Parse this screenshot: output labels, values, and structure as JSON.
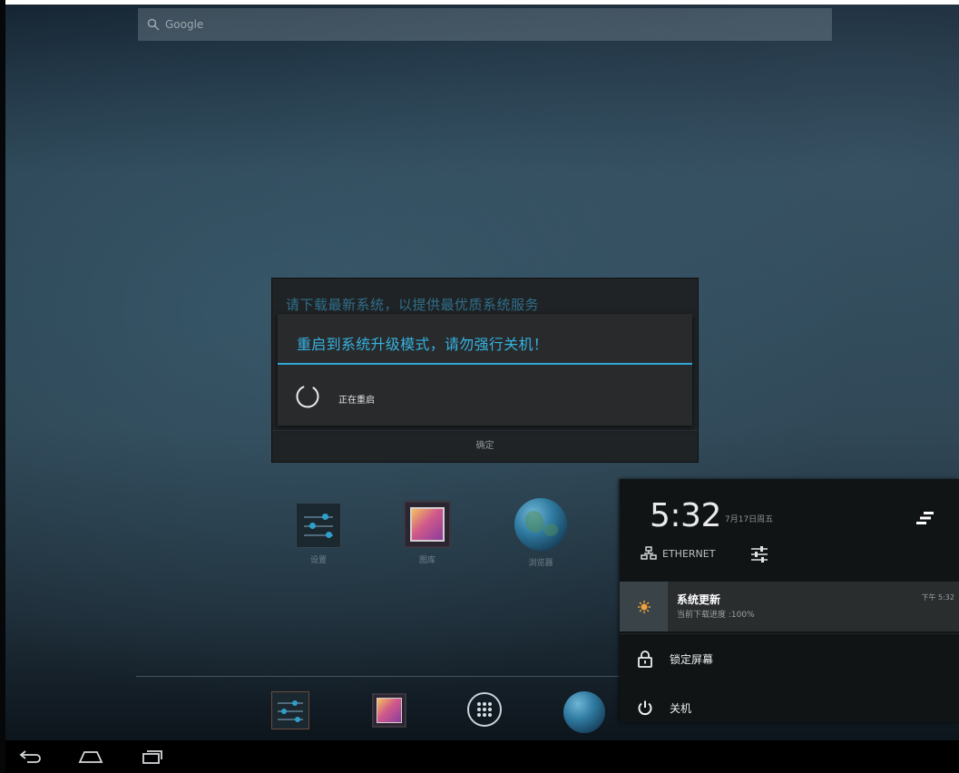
{
  "search": {
    "label": "Google"
  },
  "home_apps": [
    {
      "label": "设置",
      "icon": "settings-icon"
    },
    {
      "label": "图库",
      "icon": "gallery-icon"
    },
    {
      "label": "浏览器",
      "icon": "browser-globe-icon"
    }
  ],
  "dock": {
    "items": [
      "settings-icon",
      "gallery-icon",
      "all-apps-icon",
      "browser-globe-icon"
    ]
  },
  "background_dialog": {
    "title": "请下载最新系统，以提供最优质系统服务",
    "ok_label": "确定"
  },
  "dialog": {
    "title": "重启到系统升级模式，请勿强行关机！",
    "message": "正在重启"
  },
  "panel": {
    "time": "5:32",
    "date": "7月17日周五",
    "network_label": "ETHERNET",
    "notification": {
      "title": "系统更新",
      "subtitle": "当前下载进度 :100%",
      "time": "下午 5:32",
      "progress_percent": 100
    },
    "lock_label": "锁定屏幕",
    "power_label": "关机"
  },
  "nav": [
    "back-icon",
    "home-icon",
    "recents-icon"
  ],
  "colors": {
    "accent": "#33a7d6",
    "dialog_bg": "#282a2b",
    "panel_bg": "#111414",
    "notification_icon": "#f2a23a"
  }
}
